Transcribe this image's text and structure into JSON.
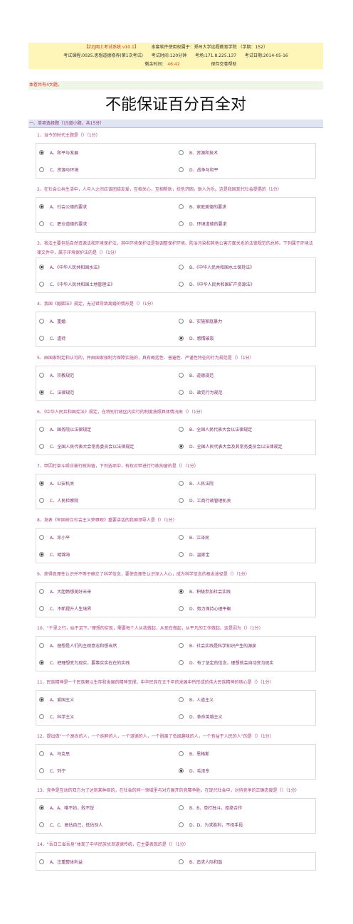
{
  "header": {
    "system": "【ZZJ网上考试系统 v10.1】",
    "license": "本套软件使用权属于：郑州大学远程教育学院 （学期：152）",
    "course": "考试课程:0025.思想道德修养(第1次考试)",
    "duration": "考试时间:120分钟",
    "venue": "考场:171.8.225.137",
    "date": "考试日期:2014-05-16",
    "remaining_label": "剩余时间：",
    "remaining_value": "46:42",
    "save_help": "保存交卷帮助"
  },
  "notice": "本卷共有4大题。",
  "headline": "不能保证百分百全对",
  "section": "一、单项选择题（15道小题，共15分）",
  "questions": [
    {
      "text": "1、当今的时代主题是（）（1分）",
      "options": [
        "A、和平与发展",
        "B、资源和技术",
        "C、资源与环境",
        "D、战争与和平"
      ],
      "selected": 0
    },
    {
      "text": "2、在社会公共生活中，人与人之间应该团结友爱，互相关心，互相帮助，扶危济困，助人为乐。这是我国现代社会提倡的（1分）",
      "options": [
        "A、社会公德的要求",
        "B、家庭美德的要求",
        "C、职业道德的要求",
        "D、环境道德的要求"
      ],
      "selected": 0
    },
    {
      "text": "3、我法主要包括自然资源法和环境保护法，其中环境保护法是指调整保护环境、防治污染和其他公害方面关系的法律规范的总称。下列属于环境法律文件中，属于环境保护法的是（）（1分）",
      "options": [
        "A、《中华人民共和国水法》",
        "B、《中华人民共和国水土保持法》",
        "C、《中华人民共和国土地管理法》",
        "D、《中华人民共和国矿产资源法》"
      ],
      "selected": 0
    },
    {
      "text": "4、我国《婚姻法》规定，无过错导致离婚的情形是（）（1分）",
      "options": [
        "A、重婚",
        "B、实施家庭暴力",
        "C、虐待",
        "D、感情破裂"
      ],
      "selected": 3
    },
    {
      "text": "5、由国家制定和认可的，并由国家强制力保障实施的，具有概括性、普遍性、严谨性特征的行为规范是（）（1分）",
      "options": [
        "A、宗教规范",
        "B、道德规范",
        "C、法律规范",
        "D、政党行为规范"
      ],
      "selected": 2
    },
    {
      "text": "6、《中华人民共和国宪法》规定，在特别行政区内实行的制度按照具体情况由（）（1分）",
      "options": [
        "A、国务院以法律规定",
        "B、全国人民代表大会以法律规定",
        "C、全国人民代表大会常务委员会以法律规定",
        "D、全国人民代表大会及其常务委员会以法律规定"
      ],
      "selected": 3
    },
    {
      "text": "7、甲因打架斗殴应被行政拘留，下列选项中，有权对甲进行行政拘留的是（）（1分）",
      "options": [
        "A、公安机关",
        "B、人民法院",
        "C、人民检察院",
        "D、工商行政管理机关"
      ],
      "selected": 0
    },
    {
      "text": "8、发表《牢固树立社会主义荣辱观》重要讲话的我国领导人是（）（1分）",
      "options": [
        "A、邓小平",
        "B、江泽民",
        "C、胡锦涛",
        "D、温家宝"
      ],
      "selected": 2
    },
    {
      "text": "9、获得真理性认识并不等于确立了科学信念，要使真理性认识深入人心，成为科学信念的根本途径是（）（1分）",
      "options": [
        "A、大胆畅想美好未来",
        "B、积极参加社会实践",
        "C、不断提升人生境界",
        "D、努力保持心理平衡"
      ],
      "selected": 1
    },
    {
      "text": "10、“千里之行，始于足下。”理想的实现，需要每个人从我做起，从现在做起，从平凡的工作做起。这是因为（）（1分）",
      "options": [
        "A、理想是人们的主观意志和想当然",
        "B、社会实践是科学知识产生的源泉",
        "C、把理想变为现实，要靠实实在在的实践",
        "D、有了坚定的信念，理想就会自动变为现实"
      ],
      "selected": 2
    },
    {
      "text": "11、民族精神是一个民族赖以生存和发展的精神支撑。中华民族在五千年的发展中所形成的伟大民族精神的核心是（）（1分）",
      "options": [
        "A、爱国主义",
        "B、人道主义",
        "C、科学主义",
        "D、革命英雄主义"
      ],
      "selected": 0
    },
    {
      "text": "12、提出做“一个高尚的人，一个纯粹的人，一个道德的人，一个脱离了低级趣味的人，一个有益于人民的人”的是（）（1分）",
      "options": [
        "A、马克思",
        "B、恩格斯",
        "C、列宁",
        "D、毛泽东"
      ],
      "selected": 3
    },
    {
      "text": "13、竞争是互动的双方为了达到某种目的，在社会的同一领域里与对方展开的竞赛争胜。在现代社会中，对待竞争的正确态度是（）（1分）",
      "options": [
        "A、A、唯不妨，败不馁",
        "B、B、单打独斗，拒绝合作",
        "C、C、高估自己，低估别人",
        "D、D、为求胜利，不择手段"
      ],
      "selected": 0
    },
    {
      "text": "14、“吾日三省吾身”体现了中华民族优良道德传统，它主要表现的是（）（1分）",
      "options": [
        "A、注重整体利益",
        "B、追求人际和谐"
      ],
      "selected": -1
    }
  ]
}
